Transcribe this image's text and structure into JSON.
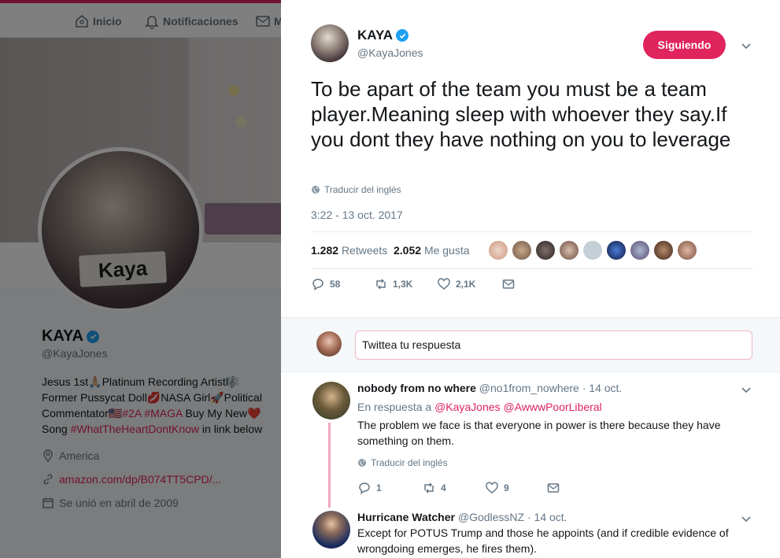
{
  "nav": {
    "home": "Inicio",
    "notifications": "Notificaciones",
    "messages_partial": "M"
  },
  "profile": {
    "avatar_text": "Kaya",
    "name": "KAYA",
    "handle": "@KayaJones",
    "bio_line1": "Jesus 1st🙏🏼Platinum Recording Artist🎼",
    "bio_line2": "Former Pussycat Doll💋NASA Girl🚀Political",
    "bio_line3a": "Commentator🇺🇸",
    "bio_tag1": "#2A",
    "bio_tag2": "#MAGA",
    "bio_line3b": " Buy My New❤️",
    "bio_line4a": "Song ",
    "bio_tag3": "#WhatTheHeartDontKnow",
    "bio_line4b": " in link below",
    "location": "America",
    "website": "amazon.com/dp/B074TT5CPD/...",
    "joined": "Se unió en abril de 2009"
  },
  "tweet": {
    "name": "KAYA",
    "handle": "@KayaJones",
    "follow_label": "Siguiendo",
    "text": "To be apart of the team you must be a team player.Meaning sleep with whoever they say.If you dont they have nothing on you to leverage",
    "translate": "Traducir del inglés",
    "timestamp": "3:22 - 13 oct. 2017",
    "retweets_count": "1.282",
    "retweets_label": "Retweets",
    "likes_count": "2.052",
    "likes_label": "Me gusta",
    "reply_count": "58",
    "retweet_count_short": "1,3K",
    "like_count_short": "2,1K"
  },
  "reply_box": {
    "placeholder": "Twittea tu respuesta"
  },
  "replies": [
    {
      "name": "nobody from no where",
      "handle": "@no1from_nowhere",
      "date": "· 14 oct.",
      "in_reply_prefix": "En respuesta a",
      "mention1": "@KayaJones",
      "mention2": "@AwwwPoorLiberal",
      "text": "The problem we face is that everyone in power is there because they have something on them.",
      "translate": "Traducir del inglés",
      "reply_count": "1",
      "retweet_count": "4",
      "like_count": "9"
    },
    {
      "name": "Hurricane Watcher",
      "handle": "@GodlessNZ",
      "date": "· 14 oct.",
      "text": "Except for POTUS Trump and those he appoints (and if credible evidence of wrongdoing emerges, he fires them)."
    }
  ],
  "colors": {
    "accent": "#e0245e",
    "verified": "#1da1f2",
    "muted": "#657786",
    "thread_line": "#f2a7c3"
  }
}
